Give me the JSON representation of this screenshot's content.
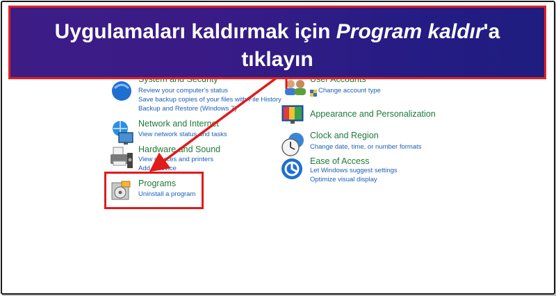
{
  "banner": {
    "prefix": "Uygulamaları kaldırmak için ",
    "emphasis": "Program kaldır",
    "suffix": "'a",
    "line2": "tıklayın"
  },
  "left_column": {
    "system_security": {
      "title": "System and Security",
      "links": [
        "Review your computer's status",
        "Save backup copies of your files with File History",
        "Backup and Restore (Windows 7)"
      ],
      "icon": "shield-icon"
    },
    "network": {
      "title": "Network and Internet",
      "links": [
        "View network status and tasks"
      ],
      "icon": "network-globe-icon"
    },
    "hardware": {
      "title": "Hardware and Sound",
      "links": [
        "View devices and printers",
        "Add a device"
      ],
      "icon": "printer-icon"
    },
    "programs": {
      "title": "Programs",
      "links": [
        "Uninstall a program"
      ],
      "icon": "programs-disc-icon"
    }
  },
  "right_column": {
    "user_accounts": {
      "title": "User Accounts",
      "links": [
        "Change account type"
      ],
      "icon": "users-icon"
    },
    "appearance": {
      "title": "Appearance and Personalization",
      "links": [],
      "icon": "monitor-palette-icon"
    },
    "clock": {
      "title": "Clock and Region",
      "links": [
        "Change date, time, or number formats"
      ],
      "icon": "clock-globe-icon"
    },
    "ease": {
      "title": "Ease of Access",
      "links": [
        "Let Windows suggest settings",
        "Optimize visual display"
      ],
      "icon": "ease-of-access-icon"
    }
  },
  "colors": {
    "banner_bg": "#3a1b86",
    "banner_border": "#e42020",
    "highlight": "#e01b1b",
    "category_title": "#1e7a37",
    "link": "#1b5fb5"
  }
}
